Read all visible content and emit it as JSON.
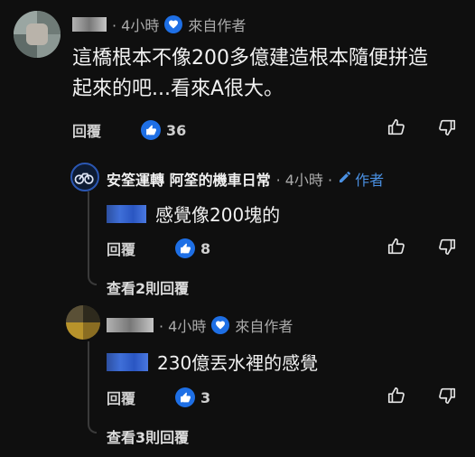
{
  "comment1": {
    "time": "· 4小時",
    "author_label": "來自作者",
    "text_line1": "這橋根本不像200多億建造根本隨便拼造",
    "text_line2": "起來的吧...看來A很大。",
    "reply_label": "回覆",
    "likes": "36"
  },
  "reply1": {
    "channel_name": "安筌運轉 阿筌的機車日常",
    "time": "· 4小時 ·",
    "creator_label": "作者",
    "text": "感覺像200塊的",
    "reply_label": "回覆",
    "likes": "8",
    "view_replies": "查看2則回覆"
  },
  "comment2": {
    "time": "· 4小時",
    "author_label": "來自作者",
    "text": "230億丟水裡的感覺",
    "reply_label": "回覆",
    "likes": "3",
    "view_replies": "查看3則回覆"
  },
  "colors": {
    "background": "#0f0f0f",
    "like_blue": "#1e6fe5",
    "creator_blue": "#4a90e2"
  }
}
